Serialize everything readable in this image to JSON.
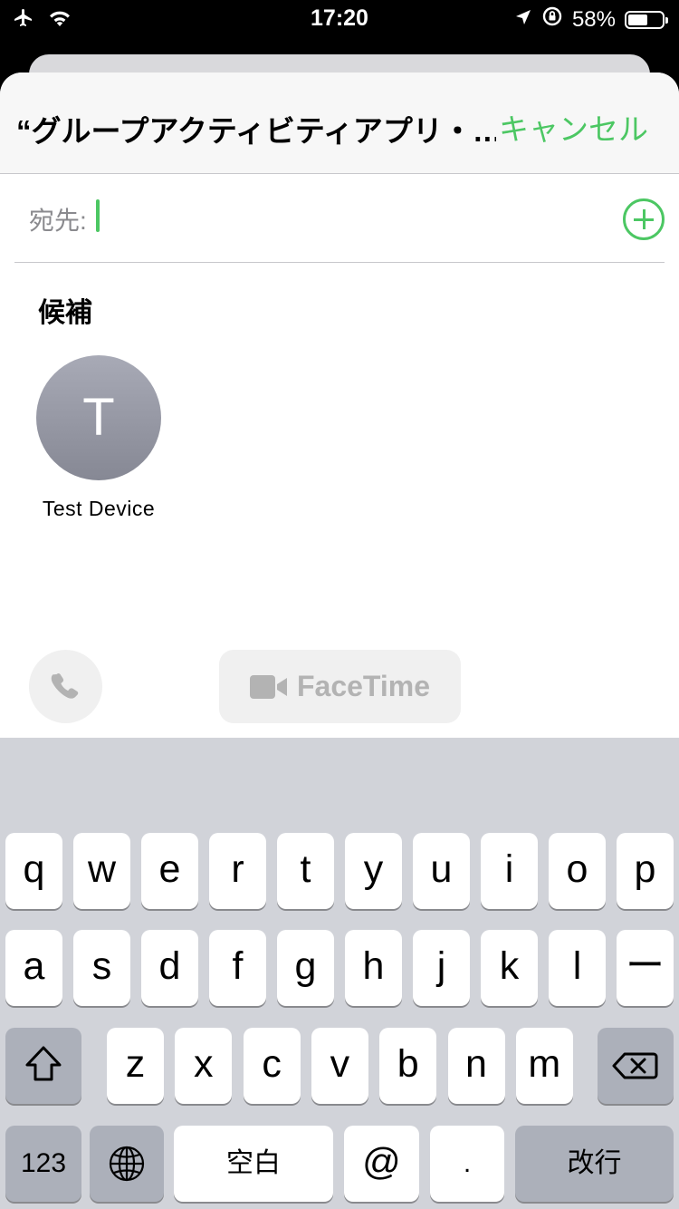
{
  "status_bar": {
    "time": "17:20",
    "battery_text": "58%",
    "battery_level": 0.58,
    "icons_left": [
      "airplane-icon",
      "wifi-icon"
    ],
    "icons_right": [
      "location-arrow-icon",
      "orientation-lock-icon"
    ]
  },
  "sheet": {
    "title": "“グループアクティビティアプリ・…",
    "cancel_label": "キャンセル",
    "to_label": "宛先:",
    "suggestions_title": "候補",
    "contact": {
      "initial": "T",
      "name": "Test Device"
    },
    "facetime_label": "FaceTime"
  },
  "keyboard": {
    "row1": [
      "q",
      "w",
      "e",
      "r",
      "t",
      "y",
      "u",
      "i",
      "o",
      "p"
    ],
    "row2": [
      "a",
      "s",
      "d",
      "f",
      "g",
      "h",
      "j",
      "k",
      "l",
      "ー"
    ],
    "row3": [
      "z",
      "x",
      "c",
      "v",
      "b",
      "n",
      "m"
    ],
    "numbers_label": "123",
    "space_label": "空白",
    "at_label": "@",
    "period_label": ".",
    "return_label": "改行"
  },
  "colors": {
    "accent": "#4cc763",
    "keyboard_bg": "#d1d3d9",
    "gray_key": "#acb0ba"
  }
}
